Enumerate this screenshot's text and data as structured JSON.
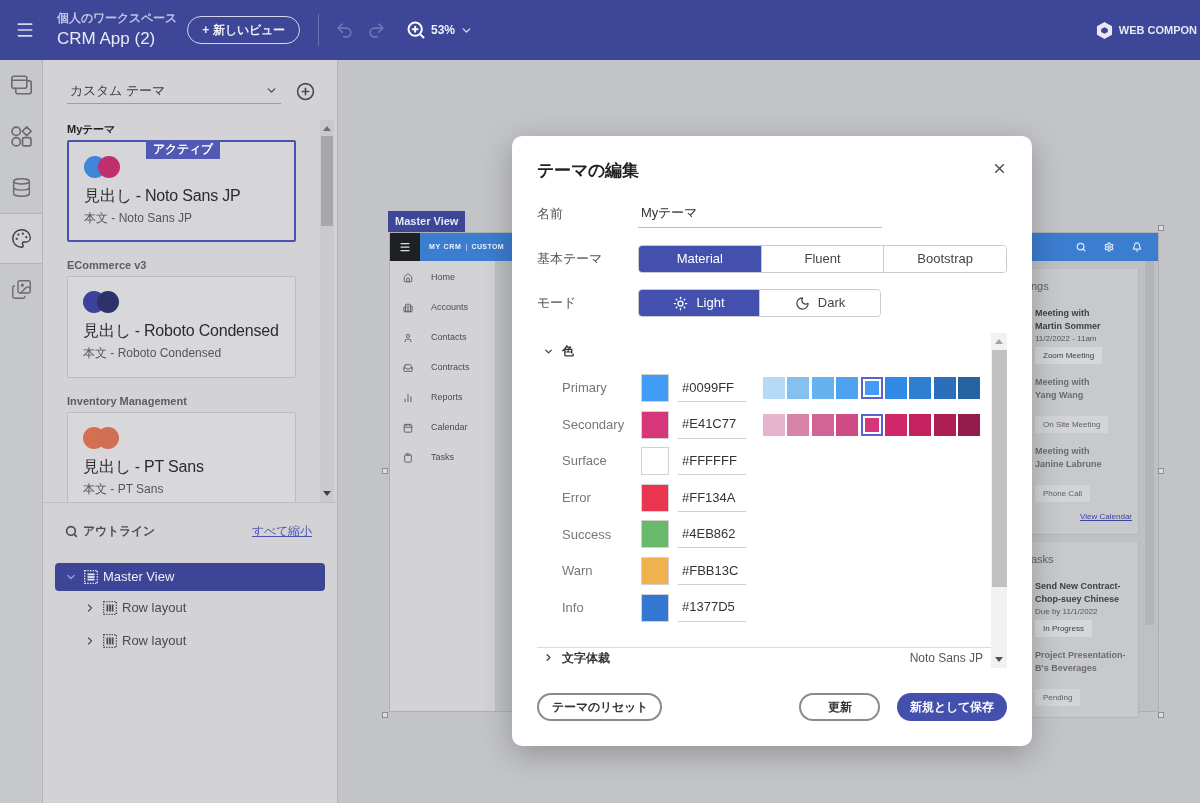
{
  "top_bar": {
    "workspace": "個人のワークスペース",
    "app_title": "CRM App (2)",
    "new_view_button": "+ 新しいビュー",
    "zoom": "53%",
    "brand": "WEB COMPON"
  },
  "rail": [
    {
      "kind": "windows",
      "selected": false
    },
    {
      "kind": "components",
      "selected": false
    },
    {
      "kind": "data",
      "selected": false
    },
    {
      "kind": "theme",
      "selected": true
    },
    {
      "kind": "assets",
      "selected": false
    }
  ],
  "theme_panel": {
    "dropdown": "カスタム テーマ",
    "themes": [
      {
        "name": "Myテーマ",
        "active": true,
        "badge": "アクティブ",
        "dots": [
          {
            "color": "#3d86d8"
          },
          {
            "color": "#c02f6c"
          }
        ],
        "heading": "見出し - Noto Sans JP",
        "body": "本文 - Noto Sans JP"
      },
      {
        "name": "ECommerce v3",
        "active": false,
        "dots": [
          {
            "color": "#3c419b"
          },
          {
            "color": "#2e3269"
          }
        ],
        "heading": "見出し - Roboto Condensed",
        "body": "本文 - Roboto Condensed"
      },
      {
        "name": "Inventory Management",
        "active": false,
        "dots": [
          {
            "color": "#d4704f"
          },
          {
            "color": "#cf6f55"
          }
        ],
        "heading": "見出し - PT Sans",
        "body": "本文 - PT Sans"
      }
    ]
  },
  "outline": {
    "title": "アウトライン",
    "collapse_link": "すべて縮小",
    "tree": [
      {
        "label": "Master View",
        "selected": true,
        "expanded": true,
        "children": [
          {
            "label": "Row layout",
            "selected": false,
            "expanded": false
          },
          {
            "label": "Row layout",
            "selected": false,
            "expanded": false
          }
        ]
      }
    ]
  },
  "canvas": {
    "view_label": "Master View",
    "preview": {
      "brand": "MY CRM",
      "separator": "|",
      "section": "CUSTOM",
      "nav": [
        {
          "kind": "home",
          "label": "Home"
        },
        {
          "kind": "accounts",
          "label": "Accounts"
        },
        {
          "kind": "contacts",
          "label": "Contacts"
        },
        {
          "kind": "contracts",
          "label": "Contracts"
        },
        {
          "kind": "reports",
          "label": "Reports"
        },
        {
          "kind": "calendar",
          "label": "Calendar"
        },
        {
          "kind": "tasks",
          "label": "Tasks"
        }
      ],
      "cards": [
        {
          "heading": "ngs",
          "items": [
            {
              "title_lines": [
                "Meeting with",
                "Martin Sommer"
              ],
              "date": "11/2/2022 - 11am",
              "button": "Zoom Meeting",
              "dimmed": false
            },
            {
              "title_lines": [
                "Meeting with",
                "Yang Wang"
              ],
              "button": "On Site Meeting",
              "dimmed": true
            },
            {
              "title_lines": [
                "Meeting with",
                "Janine Labrune"
              ],
              "button": "Phone Call",
              "dimmed": true
            }
          ],
          "link": "View Calendar"
        },
        {
          "heading": "asks",
          "items": [
            {
              "title_lines": [
                "Send New Contract-",
                "Chop-suey Chinese"
              ],
              "date": "Due by 11/1/2022",
              "button": "In Progress",
              "dimmed": false
            },
            {
              "title_lines": [
                "Project Presentation-",
                "B's Beverages"
              ],
              "button": "Pending",
              "dimmed": true
            }
          ]
        }
      ]
    }
  },
  "dialog": {
    "title": "テーマの編集",
    "name_field": {
      "label": "名前",
      "value": "Myテーマ"
    },
    "base_theme": {
      "label": "基本テーマ",
      "options": [
        {
          "label": "Material",
          "selected": true
        },
        {
          "label": "Fluent",
          "selected": false
        },
        {
          "label": "Bootstrap",
          "selected": false
        }
      ]
    },
    "mode": {
      "label": "モード",
      "options": [
        {
          "label": "Light",
          "kind": "sun",
          "selected": true
        },
        {
          "label": "Dark",
          "kind": "moon",
          "selected": false
        }
      ]
    },
    "sections": [
      {
        "title": "色",
        "expanded": true,
        "colors": [
          {
            "label": "Primary",
            "color": "#409cf4",
            "value": "#0099FF",
            "shades": [
              {
                "color": "#b4daf8",
                "selected": false
              },
              {
                "color": "#86c0ee",
                "selected": false
              },
              {
                "color": "#66b1ef",
                "selected": false
              },
              {
                "color": "#4da3ef",
                "selected": false
              },
              {
                "color": "#409cf4",
                "selected": true
              },
              {
                "color": "#3089e3",
                "selected": false
              },
              {
                "color": "#2f7fd1",
                "selected": false
              },
              {
                "color": "#2b6fbb",
                "selected": false
              },
              {
                "color": "#2661a1",
                "selected": false
              }
            ]
          },
          {
            "label": "Secondary",
            "color": "#d6367a",
            "value": "#E41C77",
            "shades": [
              {
                "color": "#e7b4cd",
                "selected": false
              },
              {
                "color": "#d884aa",
                "selected": false
              },
              {
                "color": "#d06494",
                "selected": false
              },
              {
                "color": "#cf4b84",
                "selected": false
              },
              {
                "color": "#d6367a",
                "selected": true
              },
              {
                "color": "#cf2769",
                "selected": false
              },
              {
                "color": "#c4225f",
                "selected": false
              },
              {
                "color": "#ad1e55",
                "selected": false
              },
              {
                "color": "#941b4b",
                "selected": false
              }
            ]
          },
          {
            "label": "Surface",
            "color": "#ffffff",
            "value": "#FFFFFF"
          },
          {
            "label": "Error",
            "color": "#ea3550",
            "value": "#FF134A"
          },
          {
            "label": "Success",
            "color": "#68b96b",
            "value": "#4EB862"
          },
          {
            "label": "Warn",
            "color": "#f0b24f",
            "value": "#FBB13C"
          },
          {
            "label": "Info",
            "color": "#3377d2",
            "value": "#1377D5"
          }
        ]
      },
      {
        "title": "文字体裁",
        "expanded": false,
        "value": "Noto Sans JP"
      }
    ],
    "buttons": [
      {
        "label": "テーマのリセット",
        "kind": "outline"
      },
      {
        "label": "更新",
        "kind": "outline"
      },
      {
        "label": "新規として保存",
        "kind": "primary"
      }
    ]
  }
}
